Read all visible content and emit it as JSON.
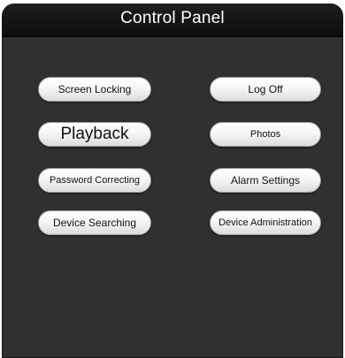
{
  "window": {
    "title": "Control Panel"
  },
  "buttons": {
    "screen_locking": "Screen Locking",
    "log_off": "Log Off",
    "playback": "Playback",
    "photos": "Photos",
    "password_correcting": "Password Correcting",
    "alarm_settings": "Alarm Settings",
    "device_searching": "Device Searching",
    "device_administration": "Device Administration"
  }
}
